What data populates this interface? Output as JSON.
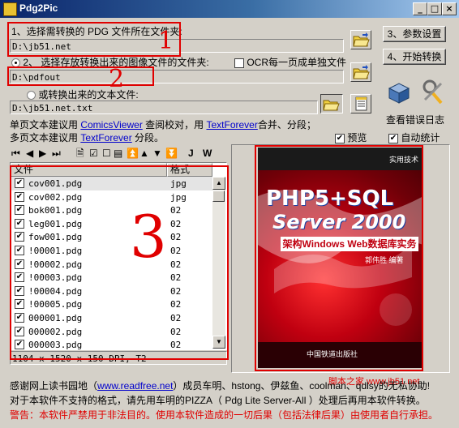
{
  "window": {
    "title": "Pdg2Pic"
  },
  "source": {
    "label": "1、选择需转换的 PDG 文件所在文件夹:",
    "path": "D:\\jb51.net"
  },
  "output": {
    "label": "2、 选择存放转换出来的图像文件的文件夹:",
    "path": "D:\\pdfout",
    "ocr_label": "OCR每一页成单独文件"
  },
  "text_output": {
    "label": "或转换出来的文本文件:",
    "path": "D:\\jb51.net.txt"
  },
  "buttons": {
    "settings": "3、参数设置",
    "start": "4、开始转换",
    "view_log": "查看错误日志"
  },
  "hints": {
    "line1_a": "单页文本建议用 ",
    "line1_link": "ComicsViewer",
    "line1_b": " 查阅校对，用 ",
    "line1_link2": "TextForever",
    "line1_c": "合并、分段；",
    "line2_a": "多页文本建议用 ",
    "line2_link": "TextForever",
    "line2_b": " 分段。"
  },
  "options": {
    "preview": "预览",
    "auto_stats": "自动统计"
  },
  "toolbar": {
    "sort_label": "J",
    "w_label": "W"
  },
  "list": {
    "col_file": "文件",
    "col_format": "格式",
    "rows": [
      {
        "name": "cov001.pdg",
        "format": "jpg"
      },
      {
        "name": "cov002.pdg",
        "format": "jpg"
      },
      {
        "name": "bok001.pdg",
        "format": "02"
      },
      {
        "name": "leg001.pdg",
        "format": "02"
      },
      {
        "name": "fow001.pdg",
        "format": "02"
      },
      {
        "name": "!00001.pdg",
        "format": "02"
      },
      {
        "name": "!00002.pdg",
        "format": "02"
      },
      {
        "name": "!00003.pdg",
        "format": "02"
      },
      {
        "name": "!00004.pdg",
        "format": "02"
      },
      {
        "name": "!00005.pdg",
        "format": "02"
      },
      {
        "name": "000001.pdg",
        "format": "02"
      },
      {
        "name": "000002.pdg",
        "format": "02"
      },
      {
        "name": "000003.pdg",
        "format": "02"
      }
    ]
  },
  "status": {
    "image_info": "1104 x 1520 x 150 DPI, T2"
  },
  "cover": {
    "badge": "实用技术",
    "title_line1": "PHP5+SQL",
    "title_line2": "Server 2000",
    "subtitle": "架构Windows Web数据库实务",
    "author": "郭伟胜 编著",
    "publisher": "中国铁道出版社",
    "watermark": "脚本之家 www.jb51.net"
  },
  "footer": {
    "thanks_a": "感谢网上读书园地（",
    "thanks_link": "www.readfree.net",
    "thanks_b": "）成员车明、hstong、伊兹鱼、coolman、qdlsy的无私协助!",
    "unsupported": "对于本软件不支持的格式，请先用车明的PIZZA（ Pdg Lite Server-All ）处理后再用本软件转换。",
    "warning": "警告：本软件严禁用于非法目的。使用本软件造成的一切后果（包括法律后果）由使用者自行承担。"
  },
  "annotations": {
    "mark1": "1",
    "mark2": "2",
    "mark3": "3"
  },
  "colors": {
    "annotation": "#e00000",
    "link": "#0000cc",
    "warning": "#e00000"
  }
}
